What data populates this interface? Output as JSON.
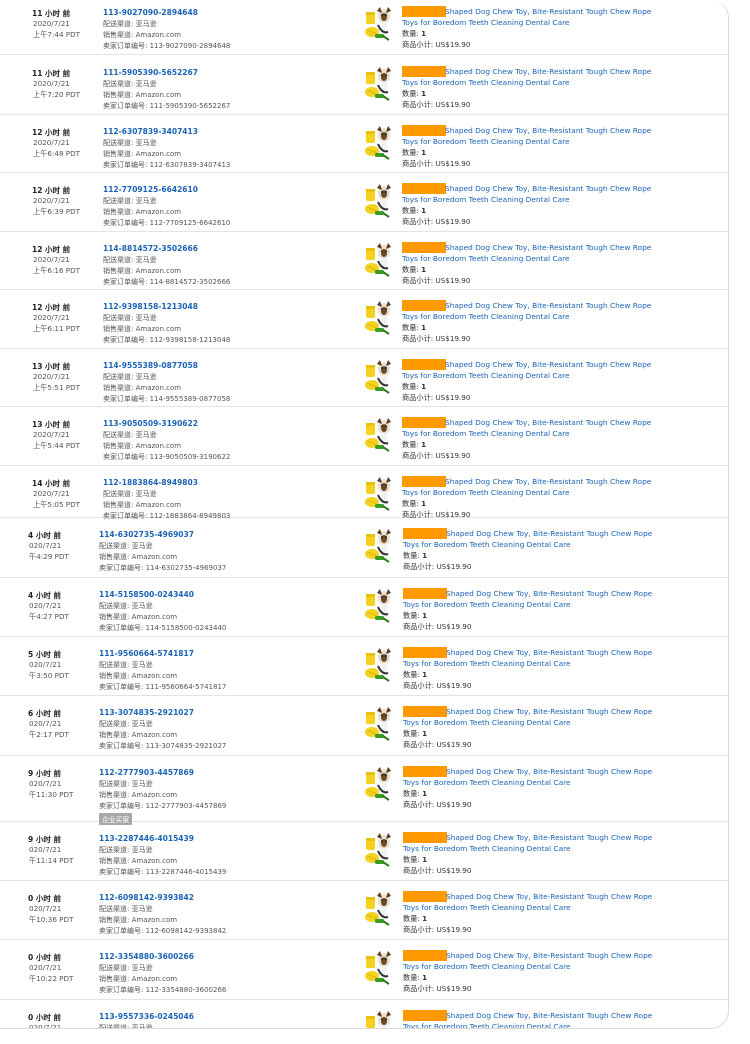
{
  "labels": {
    "channel_prefix": "配送渠道: ",
    "sales_prefix": "销售渠道: ",
    "seller_prefix": "卖家订单编号: ",
    "qty_prefix": "数量: ",
    "subtotal_prefix": "商品小计: "
  },
  "orders": [
    {
      "time_ago": "11 小时 前",
      "date": "2020/7/21",
      "time": "上午7:44 PDT",
      "order_id": "113-9027090-2894648",
      "channel": "亚马逊",
      "sales_channel": "Amazon.com",
      "seller_order_id": "113-9027090-2894648",
      "product_line1": "Shaped Dog Chew Toy, Bite-Resistant Tough Chew Rope",
      "product_line2": "Toys for Boredom Teeth Cleaning Dental Care",
      "quantity": "1",
      "subtotal": "US$19.90",
      "badge": ""
    },
    {
      "time_ago": "11 小时 前",
      "date": "2020/7/21",
      "time": "上午7:20 PDT",
      "order_id": "111-5905390-5652267",
      "channel": "亚马逊",
      "sales_channel": "Amazon.com",
      "seller_order_id": "111-5905390-5652267",
      "product_line1": "Shaped Dog Chew Toy, Bite-Resistant Tough Chew Rope",
      "product_line2": "Toys for Boredom Teeth Cleaning Dental Care",
      "quantity": "1",
      "subtotal": "US$19.90",
      "badge": ""
    },
    {
      "time_ago": "12 小时 前",
      "date": "2020/7/21",
      "time": "上午6:48 PDT",
      "order_id": "112-6307839-3407413",
      "channel": "亚马逊",
      "sales_channel": "Amazon.com",
      "seller_order_id": "112-6307839-3407413",
      "product_line1": "Shaped Dog Chew Toy, Bite-Resistant Tough Chew Rope",
      "product_line2": "Toys for Boredom Teeth Cleaning Dental Care",
      "quantity": "1",
      "subtotal": "US$19.90",
      "badge": ""
    },
    {
      "time_ago": "12 小时 前",
      "date": "2020/7/21",
      "time": "上午6:39 PDT",
      "order_id": "112-7709125-6642610",
      "channel": "亚马逊",
      "sales_channel": "Amazon.com",
      "seller_order_id": "112-7709125-6642610",
      "product_line1": "Shaped Dog Chew Toy, Bite-Resistant Tough Chew Rope",
      "product_line2": "Toys for Boredom Teeth Cleaning Dental Care",
      "quantity": "1",
      "subtotal": "US$19.90",
      "badge": ""
    },
    {
      "time_ago": "12 小时 前",
      "date": "2020/7/21",
      "time": "上午6:16 PDT",
      "order_id": "114-8814572-3502666",
      "channel": "亚马逊",
      "sales_channel": "Amazon.com",
      "seller_order_id": "114-8814572-3502666",
      "product_line1": "Shaped Dog Chew Toy, Bite-Resistant Tough Chew Rope",
      "product_line2": "Toys for Boredom Teeth Cleaning Dental Care",
      "quantity": "1",
      "subtotal": "US$19.90",
      "badge": ""
    },
    {
      "time_ago": "12 小时 前",
      "date": "2020/7/21",
      "time": "上午6:11 PDT",
      "order_id": "112-9398158-1213048",
      "channel": "亚马逊",
      "sales_channel": "Amazon.com",
      "seller_order_id": "112-9398158-1213048",
      "product_line1": "Shaped Dog Chew Toy, Bite-Resistant Tough Chew Rope",
      "product_line2": "Toys for Boredom Teeth Cleaning Dental Care",
      "quantity": "1",
      "subtotal": "US$19.90",
      "badge": ""
    },
    {
      "time_ago": "13 小时 前",
      "date": "2020/7/21",
      "time": "上午5:51 PDT",
      "order_id": "114-9555389-0877058",
      "channel": "亚马逊",
      "sales_channel": "Amazon.com",
      "seller_order_id": "114-9555389-0877058",
      "product_line1": "Shaped Dog Chew Toy, Bite-Resistant Tough Chew Rope",
      "product_line2": "Toys for Boredom Teeth Cleaning Dental Care",
      "quantity": "1",
      "subtotal": "US$19.90",
      "badge": ""
    },
    {
      "time_ago": "13 小时 前",
      "date": "2020/7/21",
      "time": "上午5:44 PDT",
      "order_id": "113-9050509-3190622",
      "channel": "亚马逊",
      "sales_channel": "Amazon.com",
      "seller_order_id": "113-9050509-3190622",
      "product_line1": "Shaped Dog Chew Toy, Bite-Resistant Tough Chew Rope",
      "product_line2": "Toys for Boredom Teeth Cleaning Dental Care",
      "quantity": "1",
      "subtotal": "US$19.90",
      "badge": ""
    },
    {
      "time_ago": "14 小时 前",
      "date": "2020/7/21",
      "time": "上午5:05 PDT",
      "order_id": "112-1883864-8949803",
      "channel": "亚马逊",
      "sales_channel": "Amazon.com",
      "seller_order_id": "112-1883864-8949803",
      "product_line1": "Shaped Dog Chew Toy, Bite-Resistant Tough Chew Rope",
      "product_line2": "Toys for Boredom Teeth Cleaning Dental Care",
      "quantity": "1",
      "subtotal": "US$19.90",
      "badge": ""
    },
    {
      "time_ago": "4 小时 前",
      "date": "020/7/21",
      "time": "午4:29 PDT",
      "order_id": "114-6302735-4969037",
      "channel": "亚马逊",
      "sales_channel": "Amazon.com",
      "seller_order_id": "114-6302735-4969037",
      "product_line1": "Shaped Dog Chew Toy, Bite-Resistant Tough Chew Rope",
      "product_line2": "Toys for Boredom Teeth Cleaning Dental Care",
      "quantity": "1",
      "subtotal": "US$19.90",
      "badge": ""
    },
    {
      "time_ago": "4 小时 前",
      "date": "020/7/21",
      "time": "午4:27 PDT",
      "order_id": "114-5158500-0243440",
      "channel": "亚马逊",
      "sales_channel": "Amazon.com",
      "seller_order_id": "114-5158500-0243440",
      "product_line1": "Shaped Dog Chew Toy, Bite-Resistant Tough Chew Rope",
      "product_line2": "Toys for Boredom Teeth Cleaning Dental Care",
      "quantity": "1",
      "subtotal": "US$19.90",
      "badge": ""
    },
    {
      "time_ago": "5 小时 前",
      "date": "020/7/21",
      "time": "午3:50 PDT",
      "order_id": "111-9560664-5741817",
      "channel": "亚马逊",
      "sales_channel": "Amazon.com",
      "seller_order_id": "111-9560664-5741817",
      "product_line1": "Shaped Dog Chew Toy, Bite-Resistant Tough Chew Rope",
      "product_line2": "Toys for Boredom Teeth Cleaning Dental Care",
      "quantity": "1",
      "subtotal": "US$19.90",
      "badge": ""
    },
    {
      "time_ago": "6 小时 前",
      "date": "020/7/21",
      "time": "午2:17 PDT",
      "order_id": "113-3074835-2921027",
      "channel": "亚马逊",
      "sales_channel": "Amazon.com",
      "seller_order_id": "113-3074835-2921027",
      "product_line1": "Shaped Dog Chew Toy, Bite-Resistant Tough Chew Rope",
      "product_line2": "Toys for Boredom Teeth Cleaning Dental Care",
      "quantity": "1",
      "subtotal": "US$19.90",
      "badge": ""
    },
    {
      "time_ago": "9 小时 前",
      "date": "020/7/21",
      "time": "午11:30 PDT",
      "order_id": "112-2777903-4457869",
      "channel": "亚马逊",
      "sales_channel": "Amazon.com",
      "seller_order_id": "112-2777903-4457869",
      "product_line1": "Shaped Dog Chew Toy, Bite-Resistant Tough Chew Rope",
      "product_line2": "Toys for Boredom Teeth Cleaning Dental Care",
      "quantity": "1",
      "subtotal": "US$19.90",
      "badge": "企业买家"
    },
    {
      "time_ago": "9 小时 前",
      "date": "020/7/21",
      "time": "午11:14 PDT",
      "order_id": "113-2287446-4015439",
      "channel": "亚马逊",
      "sales_channel": "Amazon.com",
      "seller_order_id": "113-2287446-4015439",
      "product_line1": "Shaped Dog Chew Toy, Bite-Resistant Tough Chew Rope",
      "product_line2": "Toys for Boredom Teeth Cleaning Dental Care",
      "quantity": "1",
      "subtotal": "US$19.90",
      "badge": ""
    },
    {
      "time_ago": "0 小时 前",
      "date": "020/7/21",
      "time": "午10:36 PDT",
      "order_id": "112-6098142-9393842",
      "channel": "亚马逊",
      "sales_channel": "Amazon.com",
      "seller_order_id": "112-6098142-9393842",
      "product_line1": "Shaped Dog Chew Toy, Bite-Resistant Tough Chew Rope",
      "product_line2": "Toys for Boredom Teeth Cleaning Dental Care",
      "quantity": "1",
      "subtotal": "US$19.90",
      "badge": ""
    },
    {
      "time_ago": "0 小时 前",
      "date": "020/7/21",
      "time": "午10:22 PDT",
      "order_id": "112-3354880-3600266",
      "channel": "亚马逊",
      "sales_channel": "Amazon.com",
      "seller_order_id": "112-3354880-3600266",
      "product_line1": "Shaped Dog Chew Toy, Bite-Resistant Tough Chew Rope",
      "product_line2": "Toys for Boredom Teeth Cleaning Dental Care",
      "quantity": "1",
      "subtotal": "US$19.90",
      "badge": ""
    },
    {
      "time_ago": "0 小时 前",
      "date": "020/7/21",
      "time": "",
      "order_id": "113-9557336-0245046",
      "channel": "亚马逊",
      "sales_channel": "",
      "seller_order_id": "",
      "product_line1": "Shaped Dog Chew Toy, Bite-Resistant Tough Chew Rope",
      "product_line2": "Toys for Boredom Teeth Cleaning Dental Care",
      "quantity": "",
      "subtotal": "",
      "badge": ""
    }
  ]
}
